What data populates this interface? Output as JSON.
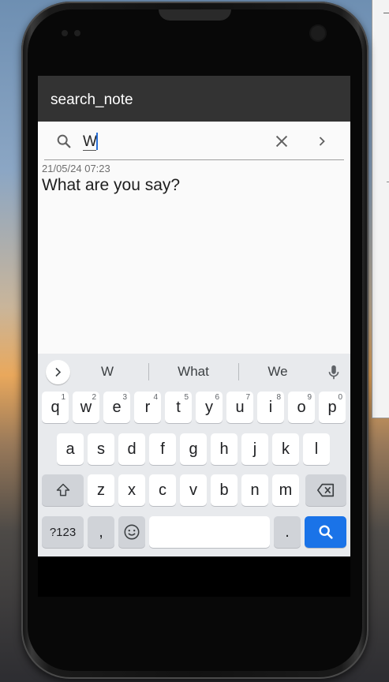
{
  "app": {
    "title": "search_note"
  },
  "search": {
    "value": "W",
    "icons": [
      "search-icon",
      "clear-icon",
      "chevron-right-icon"
    ]
  },
  "notes": [
    {
      "timestamp": "21/05/24 07:23",
      "text": "What are you say?"
    }
  ],
  "keyboard": {
    "suggestions": [
      "W",
      "What",
      "We"
    ],
    "row1": [
      {
        "k": "q",
        "h": "1"
      },
      {
        "k": "w",
        "h": "2"
      },
      {
        "k": "e",
        "h": "3"
      },
      {
        "k": "r",
        "h": "4"
      },
      {
        "k": "t",
        "h": "5"
      },
      {
        "k": "y",
        "h": "6"
      },
      {
        "k": "u",
        "h": "7"
      },
      {
        "k": "i",
        "h": "8"
      },
      {
        "k": "o",
        "h": "9"
      },
      {
        "k": "p",
        "h": "0"
      }
    ],
    "row2": [
      "a",
      "s",
      "d",
      "f",
      "g",
      "h",
      "j",
      "k",
      "l"
    ],
    "row3": [
      "z",
      "x",
      "c",
      "v",
      "b",
      "n",
      "m"
    ],
    "row4": {
      "symbols": "?123",
      "comma": ",",
      "period": "."
    },
    "colors": {
      "background": "#e8eaed",
      "key": "#ffffff",
      "function_key": "#d0d3d8",
      "action": "#1a73e8"
    }
  }
}
